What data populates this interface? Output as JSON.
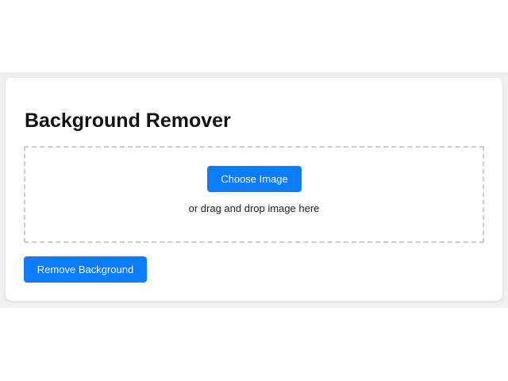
{
  "app": {
    "title": "Background Remover"
  },
  "dropzone": {
    "choose_label": "Choose Image",
    "hint": "or drag and drop image here"
  },
  "actions": {
    "remove_label": "Remove Background"
  },
  "colors": {
    "accent": "#0a7cff",
    "page_band": "#f0f0f0",
    "card": "#ffffff",
    "dropzone_border": "#cccccc"
  }
}
